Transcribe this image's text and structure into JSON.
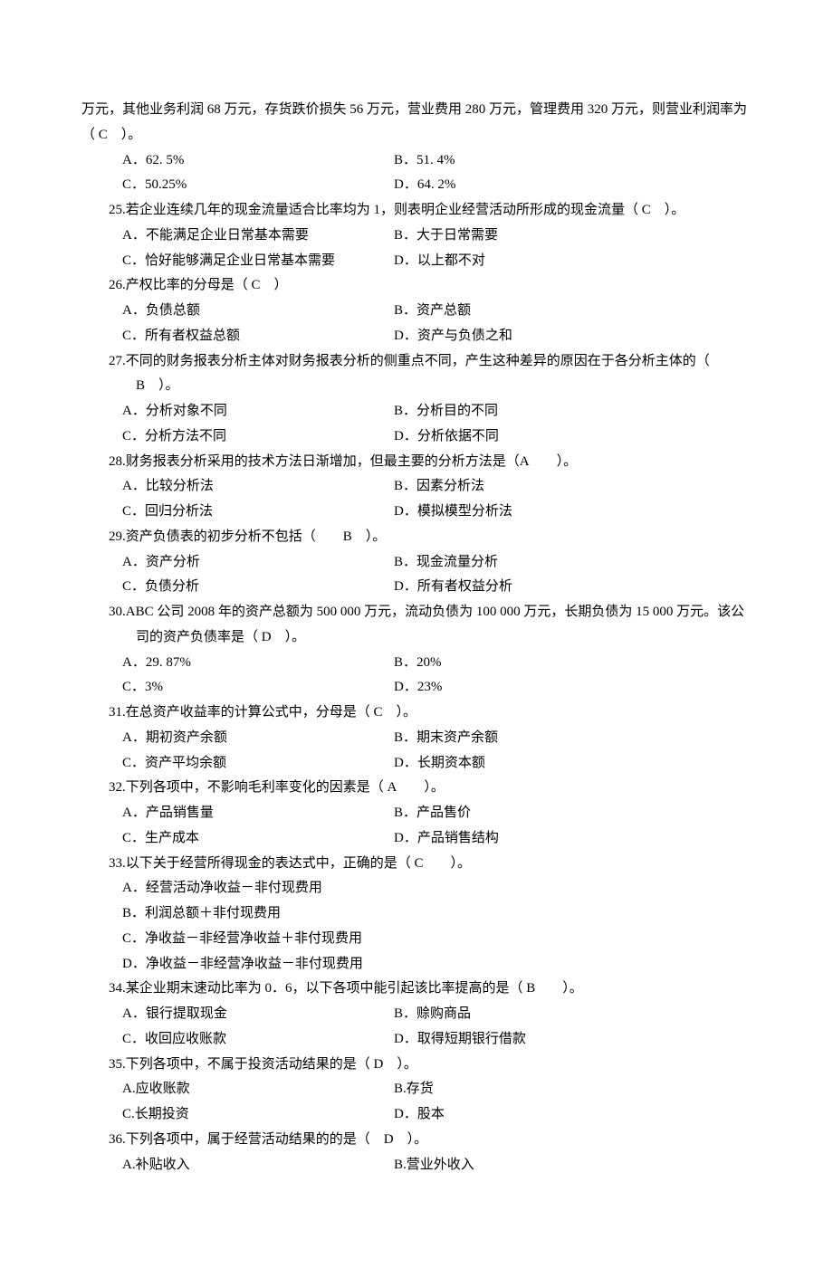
{
  "q24": {
    "preamble": "万元，其他业务利润 68 万元，存货跌价损失 56 万元，营业费用 280 万元，管理费用 320 万元，则营业利润率为（ C ）。",
    "optA": "A．62. 5%",
    "optB": "B．51. 4%",
    "optC": "C．50.25%",
    "optD": "D．64. 2%"
  },
  "q25": {
    "text": "25.若企业连续几年的现金流量适合比率均为 1，则表明企业经营活动所形成的现金流量（ C ）。",
    "optA": "A．不能满足企业日常基本需要",
    "optB": "B．大于日常需要",
    "optC": "C．恰好能够满足企业日常基本需要",
    "optD": "D．以上都不对"
  },
  "q26": {
    "text": "26.产权比率的分母是（ C ）",
    "optA": "A．负债总额",
    "optB": "B．资产总额",
    "optC": "C．所有者权益总额",
    "optD": "D．资产与负债之和"
  },
  "q27": {
    "text": "27.不同的财务报表分析主体对财务报表分析的侧重点不同，产生这种差异的原因在于各分析主体的（ B ）。",
    "optA": "A．分析对象不同",
    "optB": "B．分析目的不同",
    "optC": "C．分析方法不同",
    "optD": "D．分析依据不同"
  },
  "q28": {
    "text": "28.财务报表分析采用的技术方法日渐增加，但最主要的分析方法是（A  ）。",
    "optA": "A．比较分析法",
    "optB": "B．因素分析法",
    "optC": "C．回归分析法",
    "optD": "D．模拟模型分析法"
  },
  "q29": {
    "text": "29.资产负债表的初步分析不包括（  B ）。",
    "optA": "A．资产分析",
    "optB": "B．现金流量分析",
    "optC": "C．负债分析",
    "optD": "D．所有者权益分析"
  },
  "q30": {
    "text": "30.ABC 公司 2008 年的资产总额为 500 000 万元，流动负债为 100 000 万元，长期负债为 15 000 万元。该公司的资产负债率是（ D ）。",
    "optA": "A．29. 87%",
    "optB": "B．20%",
    "optC": "C．3%",
    "optD": "D．23%"
  },
  "q31": {
    "text": "31.在总资产收益率的计算公式中，分母是（ C ）。",
    "optA": "A．期初资产余额",
    "optB": "B．期末资产余额",
    "optC": "C．资产平均余额",
    "optD": "D．长期资本额"
  },
  "q32": {
    "text": "32.下列各项中，不影响毛利率变化的因素是（ A  ）。",
    "optA": "A．产品销售量",
    "optB": "B．产品售价",
    "optC": "C．生产成本",
    "optD": "D．产品销售结构"
  },
  "q33": {
    "text": "33.以下关于经营所得现金的表达式中，正确的是（ C  ）。",
    "optA": "A．经营活动净收益－非付现费用",
    "optB": "B．利润总额＋非付现费用",
    "optC": "C．净收益－非经营净收益＋非付现费用",
    "optD": "D．净收益－非经营净收益－非付现费用"
  },
  "q34": {
    "text": "34.某企业期末速动比率为 0．6，以下各项中能引起该比率提高的是（ B  ）。",
    "optA": "A．银行提取现金",
    "optB": "B．赊购商品",
    "optC": "C．收回应收账款",
    "optD": "D．取得短期银行借款"
  },
  "q35": {
    "text": "35.下列各项中，不属于投资活动结果的是（ D ）。",
    "optA": "A.应收账款",
    "optB": "B.存货",
    "optC": "C.长期投资",
    "optD": "D．股本"
  },
  "q36": {
    "text": "36.下列各项中，属于经营活动结果的的是（ D ）。",
    "optA": "A.补贴收入",
    "optB": "B.营业外收入"
  }
}
